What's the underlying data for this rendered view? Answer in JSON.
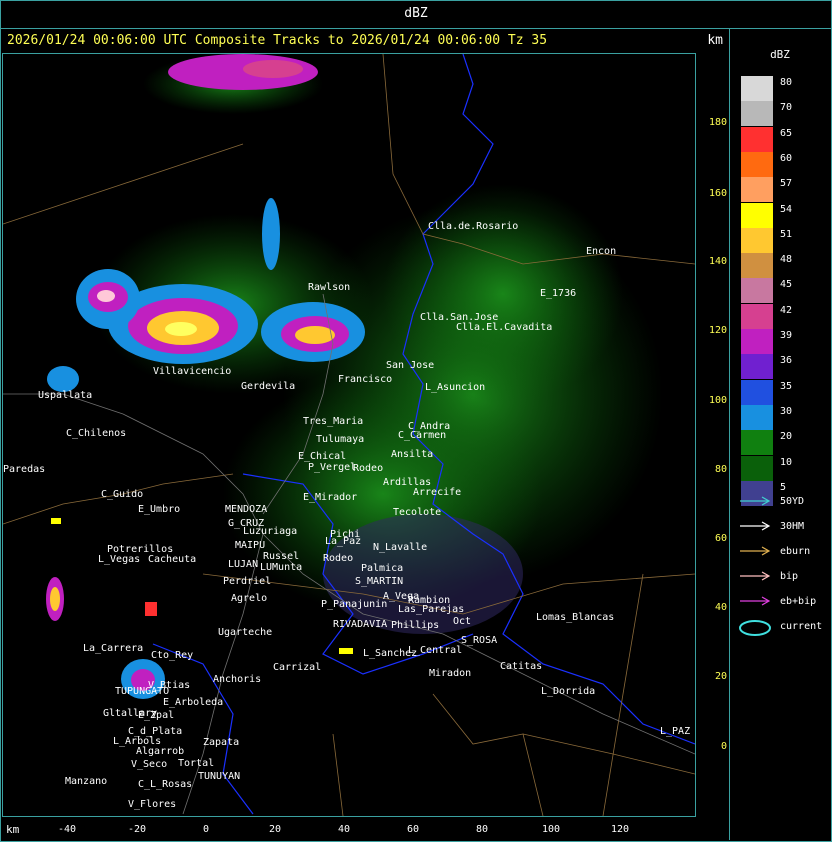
{
  "header": {
    "product": "dBZ"
  },
  "title": {
    "text": "2026/01/24 00:06:00 UTC Composite Tracks to 2026/01/24 00:06:00 Tz 35",
    "unit": "km"
  },
  "axes": {
    "x_unit": "km",
    "x_ticks": [
      "-40",
      "-20",
      "0",
      "20",
      "40",
      "60",
      "80",
      "100",
      "120"
    ],
    "y_ticks": [
      "180",
      "160",
      "140",
      "120",
      "100",
      "80",
      "60",
      "40",
      "20",
      "0"
    ]
  },
  "colorbar": {
    "unit": "dBZ",
    "levels": [
      {
        "label": "80",
        "color": "#d8d8d8"
      },
      {
        "label": "70",
        "color": "#b8b8b8"
      },
      {
        "label": "65",
        "color": "#ff3030"
      },
      {
        "label": "60",
        "color": "#ff6a10"
      },
      {
        "label": "57",
        "color": "#ff9f60"
      },
      {
        "label": "54",
        "color": "#ffff00"
      },
      {
        "label": "51",
        "color": "#ffc830"
      },
      {
        "label": "48",
        "color": "#d09040"
      },
      {
        "label": "45",
        "color": "#c878a0"
      },
      {
        "label": "42",
        "color": "#d64090"
      },
      {
        "label": "39",
        "color": "#c020c0"
      },
      {
        "label": "36",
        "color": "#7020d0"
      },
      {
        "label": "35",
        "color": "#2050e0"
      },
      {
        "label": "30",
        "color": "#1890e0"
      },
      {
        "label": "20",
        "color": "#108010"
      },
      {
        "label": "10",
        "color": "#0a600a"
      },
      {
        "label": "5",
        "color": "#404090"
      }
    ]
  },
  "legend": [
    {
      "label": "50YD",
      "color": "#40d0d0",
      "kind": "arrow"
    },
    {
      "label": "30HM",
      "color": "#ffffff",
      "kind": "arrow"
    },
    {
      "label": "eburn",
      "color": "#e0b050",
      "kind": "arrow"
    },
    {
      "label": "bip",
      "color": "#ffc0c0",
      "kind": "arrow"
    },
    {
      "label": "eb+bip",
      "color": "#e040e0",
      "kind": "arrow"
    },
    {
      "label": "current",
      "color": "#40e0e0",
      "kind": "ellipse"
    }
  ],
  "places": [
    "Clla.de.Rosario",
    "Encon",
    "Rawlson",
    "E_1736",
    "Clla.San.Jose",
    "Clla.El.Cavadita",
    "San Jose",
    "Villavicencio",
    "Gerdevila",
    "Francisco",
    "L_Asuncion",
    "Uspallata",
    "Tres_Maria",
    "C_Andra",
    "Tulumaya",
    "C_Chilenos",
    "C_Carmen",
    "E_Chical",
    "Ansilta",
    "P_Vergel",
    "Rodeo",
    "E_Mirador",
    "Ardillas",
    "C_Guido",
    "E_Umbro",
    "Arrecife",
    "MENDOZA",
    "G_CRUZ",
    "Tecolote",
    "Luzuriaga",
    "La_Paz",
    "Pichi",
    "MAIPU",
    "Russel",
    "N_Lavalle",
    "Potrerillos",
    "L_Vegas",
    "Cacheuta",
    "LUJAN",
    "LUMunta",
    "Rodeo",
    "Palmica",
    "S_MARTIN",
    "Perdriel",
    "A_Vega",
    "Agrelo",
    "P_Panajunin",
    "Rambion",
    "Las_Parejas",
    "Lomas_Blancas",
    "Ugarteche",
    "RIVADAVIA",
    "Phillips",
    "Oct",
    "La_Carrera",
    "Cto_Rey",
    "S_ROSA",
    "Carrizal",
    "L_Sanchez",
    "Catitas",
    "Anchoris",
    "L_Central",
    "Miradon",
    "V_Btias",
    "TUPUNGATO",
    "L_Dorrida",
    "E_Arboleda",
    "Gltallary",
    "E_Zpal",
    "C_d_Plata",
    "L_PAZ",
    "L_Arbols",
    "Zapata",
    "Algarrob",
    "V_Seco",
    "Tortal",
    "TUNUYAN",
    "Manzano",
    "C_L_Rosas",
    "V_Flores",
    "Paredas"
  ]
}
